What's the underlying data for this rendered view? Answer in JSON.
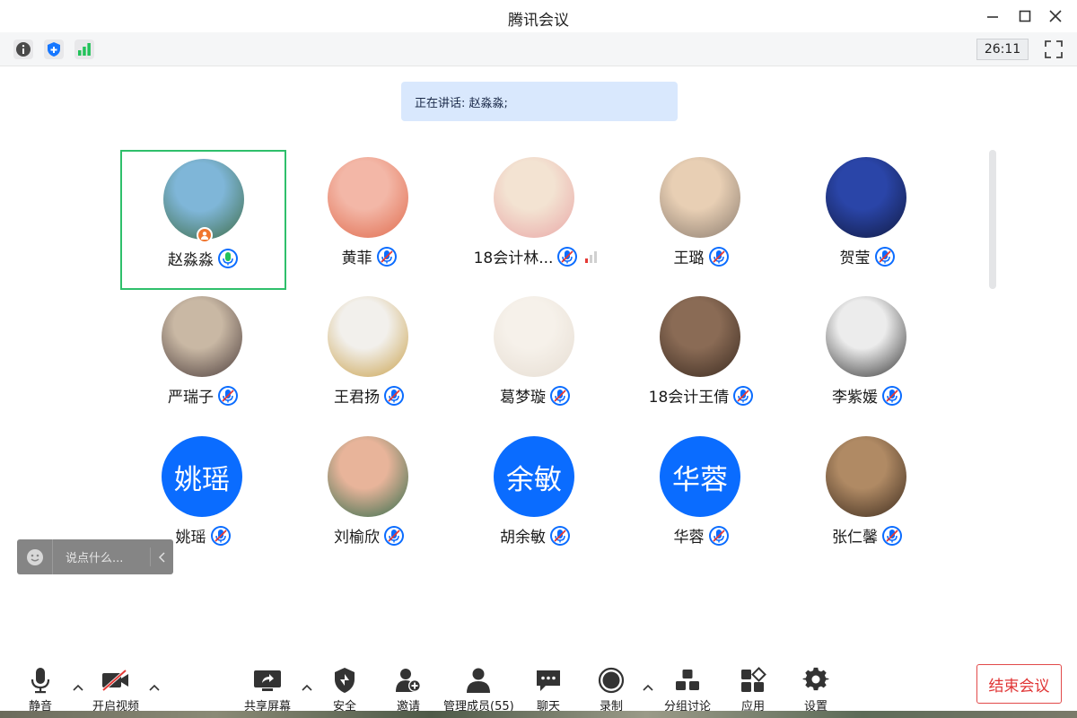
{
  "window": {
    "title": "腾讯会议"
  },
  "infobar": {
    "timer": "26:11"
  },
  "speaking": {
    "text": "正在讲话: 赵淼淼;"
  },
  "participants": [
    {
      "name": "赵淼淼",
      "avatar": "photo",
      "colors": [
        "#7fb6d8",
        "#3d6b44"
      ],
      "host": true,
      "active": true,
      "mic": "on"
    },
    {
      "name": "黄菲",
      "avatar": "photo",
      "colors": [
        "#f3b7a7",
        "#e06a4c"
      ],
      "mic": "muted"
    },
    {
      "name": "18会计林...",
      "avatar": "photo",
      "colors": [
        "#f3e3d2",
        "#e9a6a6"
      ],
      "mic": "muted",
      "signal": true
    },
    {
      "name": "王璐",
      "avatar": "photo",
      "colors": [
        "#e8cfb4",
        "#8a7b6e"
      ],
      "mic": "muted"
    },
    {
      "name": "贺莹",
      "avatar": "photo",
      "colors": [
        "#2a45a8",
        "#111a40"
      ],
      "mic": "muted"
    },
    {
      "name": "严瑞子",
      "avatar": "photo",
      "colors": [
        "#c9b8a4",
        "#4a3b3a"
      ],
      "mic": "muted"
    },
    {
      "name": "王君扬",
      "avatar": "photo",
      "colors": [
        "#f2f0ec",
        "#c9a04a"
      ],
      "mic": "muted"
    },
    {
      "name": "葛梦璇",
      "avatar": "photo",
      "colors": [
        "#f6f1ea",
        "#e6ddd2"
      ],
      "mic": "muted"
    },
    {
      "name": "18会计王倩",
      "avatar": "photo",
      "colors": [
        "#8a6b55",
        "#3a2a20"
      ],
      "mic": "muted"
    },
    {
      "name": "李紫媛",
      "avatar": "photo",
      "colors": [
        "#ececec",
        "#333333"
      ],
      "mic": "muted"
    },
    {
      "name": "姚瑶",
      "avatar": "text",
      "avatar_text": "姚瑶",
      "mic": "muted"
    },
    {
      "name": "刘榆欣",
      "avatar": "photo",
      "colors": [
        "#e8b49a",
        "#2f6b4a"
      ],
      "mic": "muted"
    },
    {
      "name": "胡余敏",
      "avatar": "text",
      "avatar_text": "余敏",
      "mic": "muted"
    },
    {
      "name": "华蓉",
      "avatar": "text",
      "avatar_text": "华蓉",
      "mic": "muted"
    },
    {
      "name": "张仁馨",
      "avatar": "photo",
      "colors": [
        "#b08a64",
        "#3b2a1d"
      ],
      "mic": "muted"
    }
  ],
  "chat": {
    "placeholder": "说点什么..."
  },
  "toolbar": {
    "mute": "静音",
    "video": "开启视频",
    "share": "共享屏幕",
    "security": "安全",
    "invite": "邀请",
    "members": "管理成员(55)",
    "chat": "聊天",
    "record": "录制",
    "breakout": "分组讨论",
    "apps": "应用",
    "settings": "设置",
    "end": "结束会议"
  },
  "colors": {
    "accent": "#0a6cff",
    "active_border": "#2fbf6b",
    "end": "#e03535",
    "signal": "#22c25a"
  }
}
